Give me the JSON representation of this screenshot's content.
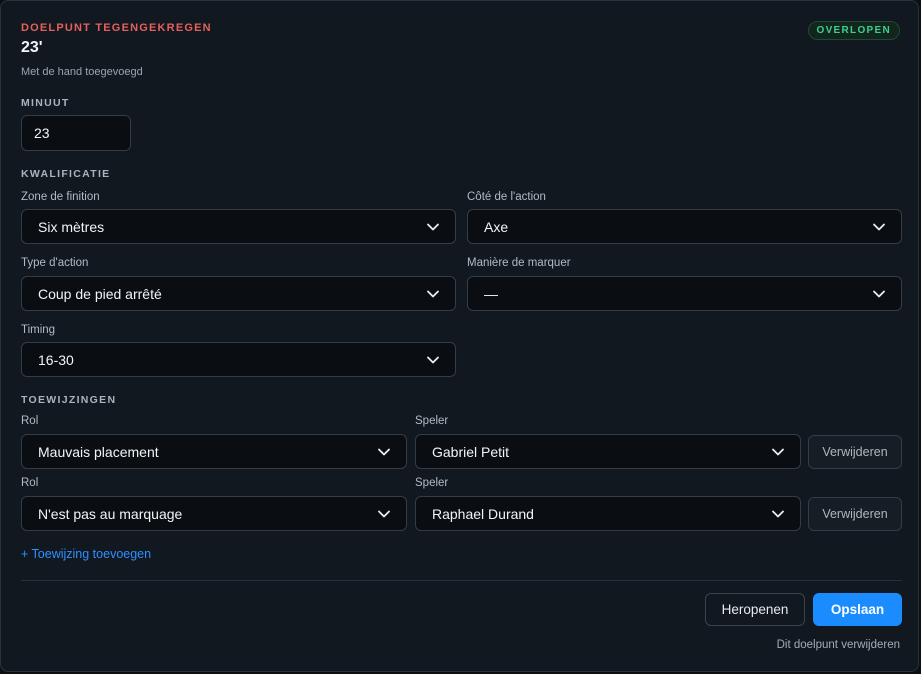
{
  "header": {
    "eyebrow": "DOELPUNT TEGENGEKREGEN",
    "minute_display": "23'",
    "subtitle": "Met de hand toegevoegd",
    "status_badge": "OVERLOPEN"
  },
  "minute": {
    "label": "MINUUT",
    "value": "23"
  },
  "qualification": {
    "section_title": "KWALIFICATIE",
    "zone": {
      "label": "Zone de finition",
      "value": "Six mètres"
    },
    "side": {
      "label": "Côté de l'action",
      "value": "Axe"
    },
    "action_type": {
      "label": "Type d'action",
      "value": "Coup de pied arrêté"
    },
    "scoring_manner": {
      "label": "Manière de marquer",
      "value": "—"
    },
    "timing": {
      "label": "Timing",
      "value": "16-30"
    }
  },
  "assignments": {
    "section_title": "TOEWIJZINGEN",
    "role_label": "Rol",
    "player_label": "Speler",
    "remove_label": "Verwijderen",
    "rows": [
      {
        "role": "Mauvais placement",
        "player": "Gabriel Petit"
      },
      {
        "role": "N'est pas au marquage",
        "player": "Raphael Durand"
      }
    ],
    "add_label": "+ Toewijzing toevoegen"
  },
  "footer": {
    "reopen_label": "Heropenen",
    "save_label": "Opslaan",
    "delete_label": "Dit doelpunt verwijderen"
  },
  "colors": {
    "accent": "#1a8cff",
    "danger_text": "#e5605a",
    "success": "#3ecf8e",
    "background": "#111820"
  }
}
